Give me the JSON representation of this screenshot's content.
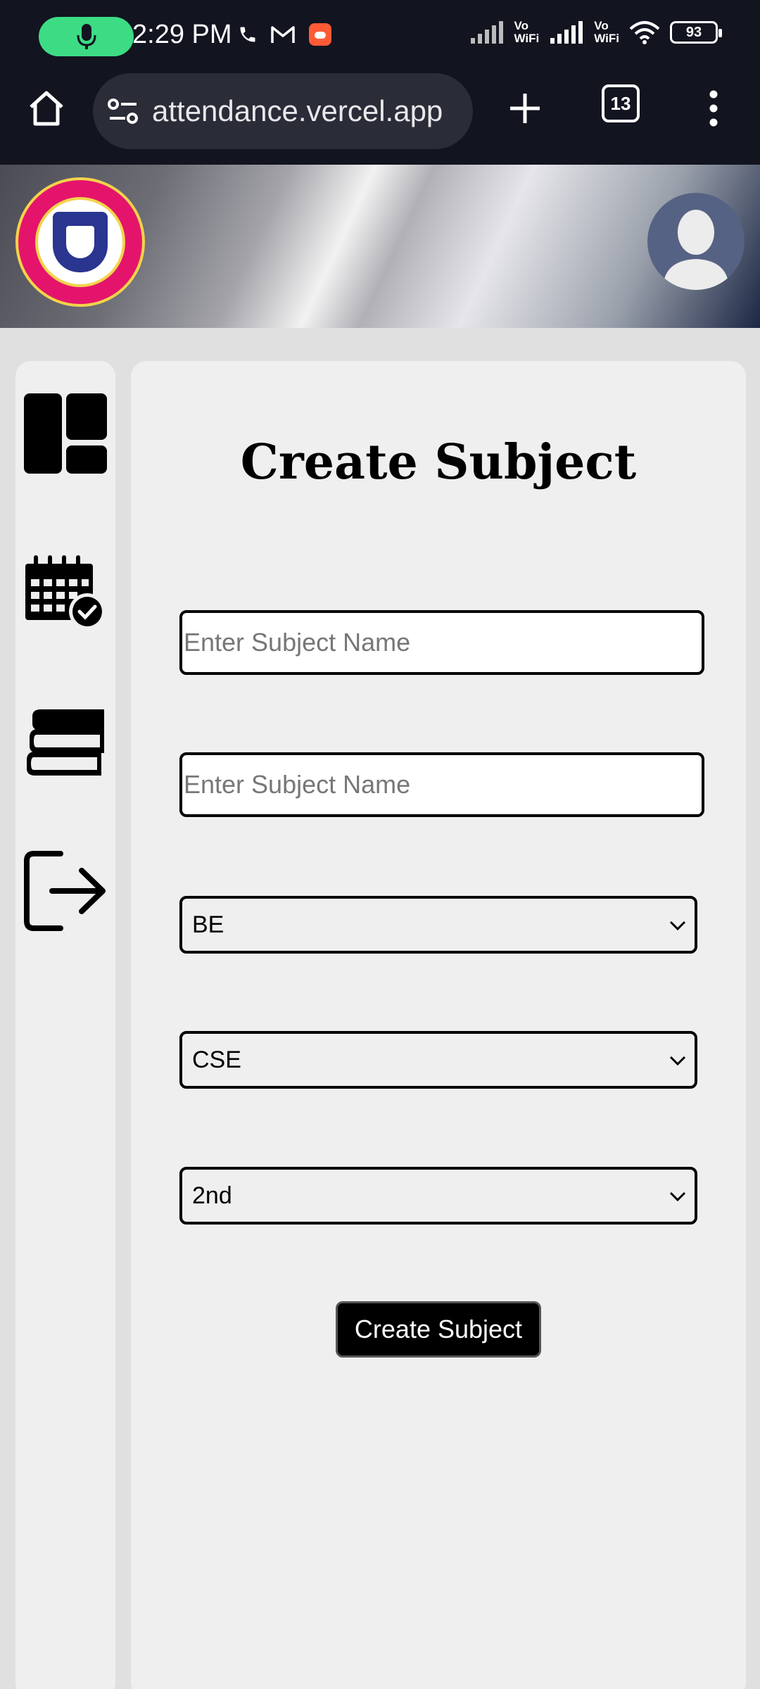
{
  "status_bar": {
    "time": "2:29 PM",
    "battery": "93",
    "network_label_1": "Vo\nWiFi",
    "network_label_2": "Vo\nWiFi",
    "icons": [
      "mic-icon",
      "phone-icon",
      "gmail-icon",
      "app-notification-icon",
      "signal-icon",
      "wifi-icon",
      "battery-icon"
    ]
  },
  "browser": {
    "url": "attendance.vercel.app",
    "tab_count": "13",
    "icons": [
      "home-icon",
      "site-settings-icon",
      "plus-icon",
      "tabs-icon",
      "more-vert-icon"
    ]
  },
  "header": {
    "logo_icons": [
      "university-logo"
    ],
    "avatar_icon": "user-avatar-icon"
  },
  "sidebar": {
    "items": [
      {
        "icon": "dashboard-icon"
      },
      {
        "icon": "attendance-calendar-icon"
      },
      {
        "icon": "books-icon"
      },
      {
        "icon": "logout-icon"
      }
    ]
  },
  "form": {
    "title": "Create Subject",
    "subject_name_placeholder_1": "Enter Subject Name",
    "subject_name_placeholder_2": "Enter Subject Name",
    "degree_selected": "BE",
    "branch_selected": "CSE",
    "semester_selected": "2nd",
    "submit_label": "Create Subject"
  },
  "colors": {
    "status_bg": "#121420",
    "mic_green": "#3ddc84",
    "card_bg": "#efefef",
    "page_bg": "#e0e0e0",
    "button_bg": "#000000"
  }
}
